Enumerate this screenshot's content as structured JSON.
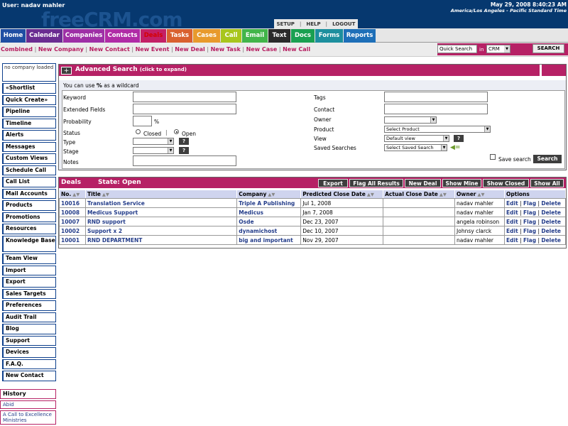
{
  "header": {
    "user": "User: nadav mahler",
    "logo": "freeCRM.com",
    "date": "May 29, 2008 8:40:23 AM",
    "timezone": "America/Los Angeles - Pacific Standard Time",
    "toplinks": [
      "SETUP",
      "HELP",
      "LOGOUT"
    ]
  },
  "tabs": [
    {
      "label": "Home",
      "color": "#1f4ea3"
    },
    {
      "label": "Calendar",
      "color": "#6a2c91"
    },
    {
      "label": "Companies",
      "color": "#9e2fa6"
    },
    {
      "label": "Contacts",
      "color": "#b02ba6"
    },
    {
      "label": "Deals",
      "color": "#c41f65"
    },
    {
      "label": "Tasks",
      "color": "#d9602f"
    },
    {
      "label": "Cases",
      "color": "#e89a2c"
    },
    {
      "label": "Call",
      "color": "#a8c61c"
    },
    {
      "label": "Email",
      "color": "#42b54a"
    },
    {
      "label": "Text",
      "color": "#2a2a2a"
    },
    {
      "label": "Docs",
      "color": "#1aa051"
    },
    {
      "label": "Forms",
      "color": "#1d8f9e"
    },
    {
      "label": "Reports",
      "color": "#1e6fb8"
    }
  ],
  "quicklinks": [
    "Combined",
    "New Company",
    "New Contact",
    "New Event",
    "New Deal",
    "New Task",
    "New Case",
    "New Call"
  ],
  "quicksearch": {
    "value": "Quick Search",
    "in_label": "in",
    "scope": "CRM",
    "button": "SEARCH"
  },
  "sidebar": {
    "company": "no company loaded",
    "items": [
      "«Shortlist",
      "Quick Create»",
      "Pipeline",
      "Timeline",
      "Alerts",
      "Messages",
      "Custom Views",
      "Schedule Call",
      "Call List",
      "Mail Accounts",
      "Products",
      "Promotions",
      "Resources",
      "Knowledge Base",
      "Team View",
      "Import",
      "Export",
      "Sales Targets",
      "Preferences",
      "Audit Trail",
      "Blog",
      "Support",
      "Devices",
      "F.A.Q.",
      "New Contact"
    ],
    "history_label": "History",
    "history": [
      "Abid",
      "A Call to Excellence Ministries"
    ]
  },
  "advanced_search": {
    "title": "Advanced Search",
    "expand_hint": "(click to expand)",
    "wildcard_pre": "You can use",
    "wildcard_symbol": "%",
    "wildcard_post": "as a wildcard",
    "labels": {
      "keyword": "Keyword",
      "extended": "Extended Fields",
      "probability": "Probability",
      "percent": "%",
      "status": "Status",
      "closed": "Closed",
      "open": "Open",
      "type": "Type",
      "stage": "Stage",
      "notes": "Notes",
      "tags": "Tags",
      "contact": "Contact",
      "owner": "Owner",
      "product": "Product",
      "view": "View",
      "saved": "Saved Searches",
      "save_search": "Save search"
    },
    "product_value": "Select Product",
    "view_value": "Default view",
    "saved_value": "Select Saved Search",
    "search_button": "Search"
  },
  "deals": {
    "title": "Deals",
    "state": "State: Open",
    "buttons": [
      "Export",
      "Flag All Results",
      "New Deal",
      "Show Mine",
      "Show Closed",
      "Show All"
    ],
    "columns": [
      "No.",
      "Title",
      "Company",
      "Predicted Close Date",
      "Actual Close Date",
      "Owner",
      "Options"
    ],
    "options": [
      "Edit",
      "Flag",
      "Delete"
    ],
    "rows": [
      {
        "no": "10016",
        "title": "Translation Service",
        "company": "Triple A Publishing",
        "predicted": "Jul 1, 2008",
        "actual": "",
        "owner": "nadav mahler"
      },
      {
        "no": "10008",
        "title": "Medicus Support",
        "company": "Medicus",
        "predicted": "Jan 7, 2008",
        "actual": "",
        "owner": "nadav mahler"
      },
      {
        "no": "10007",
        "title": "RND support",
        "company": "Osde",
        "predicted": "Dec 23, 2007",
        "actual": "",
        "owner": "angela robinson"
      },
      {
        "no": "10002",
        "title": "Support x 2",
        "company": "dynamichost",
        "predicted": "Dec 10, 2007",
        "actual": "",
        "owner": "Johnsy clarck"
      },
      {
        "no": "10001",
        "title": "RND DEPARTMENT",
        "company": "big and important",
        "predicted": "Nov 29, 2007",
        "actual": "",
        "owner": "nadav mahler"
      }
    ]
  }
}
